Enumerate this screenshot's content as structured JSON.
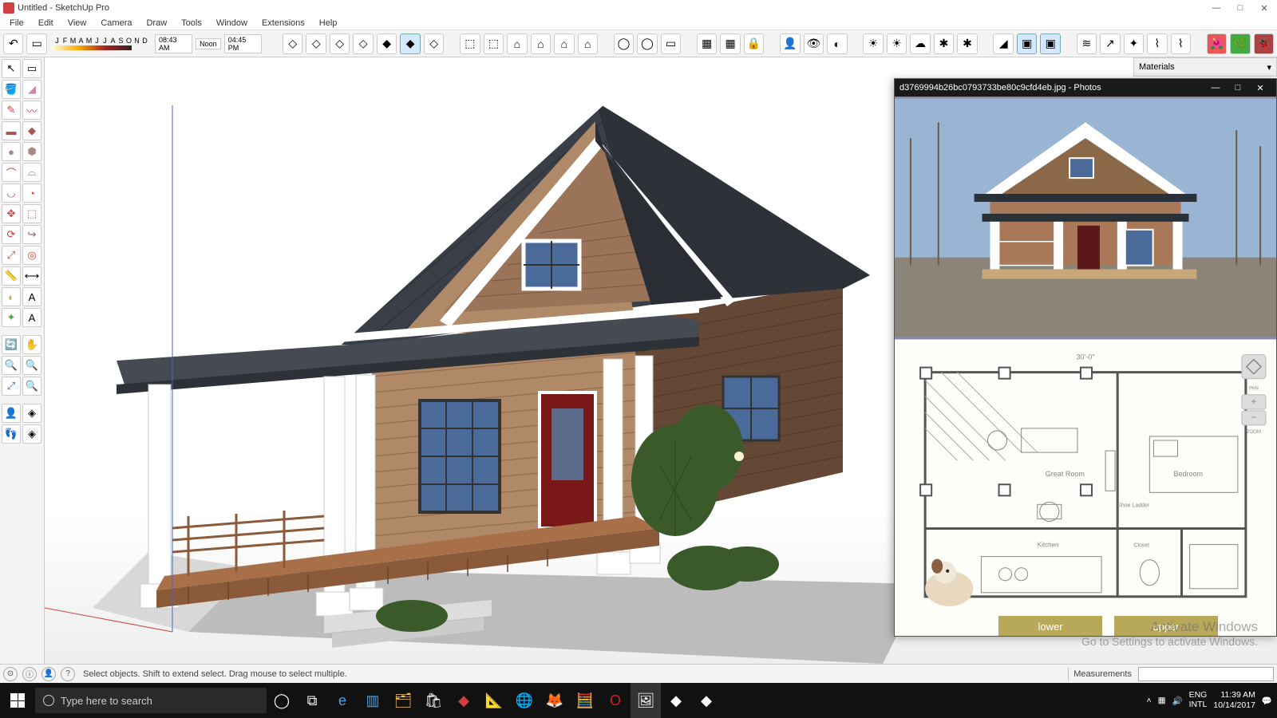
{
  "titlebar": {
    "title": "Untitled - SketchUp Pro"
  },
  "menu": [
    "File",
    "Edit",
    "View",
    "Camera",
    "Draw",
    "Tools",
    "Window",
    "Extensions",
    "Help"
  ],
  "months": [
    "J",
    "F",
    "M",
    "A",
    "M",
    "J",
    "J",
    "A",
    "S",
    "O",
    "N",
    "D"
  ],
  "times": {
    "left": "08:43 AM",
    "mid": "Noon",
    "right": "04:45 PM"
  },
  "materials_panel": {
    "title": "Materials"
  },
  "photos_window": {
    "title": "d3769994b26bc0793733be80c9cfd4eb.jpg - Photos",
    "floorplan": {
      "width_label": "30'-0\"",
      "rooms": [
        "Great Room",
        "Bedroom",
        "Kitchen",
        "Closet",
        "Shoe Ladder"
      ],
      "btn_lower": "lower",
      "btn_upper": "upper"
    }
  },
  "status": {
    "hint": "Select objects. Shift to extend select. Drag mouse to select multiple.",
    "measurements_label": "Measurements"
  },
  "watermark": {
    "line1": "Activate Windows",
    "line2": "Go to Settings to activate Windows."
  },
  "taskbar": {
    "search_placeholder": "Type here to search",
    "lang1": "ENG",
    "lang2": "INTL",
    "time": "11:39 AM",
    "date": "10/14/2017"
  }
}
